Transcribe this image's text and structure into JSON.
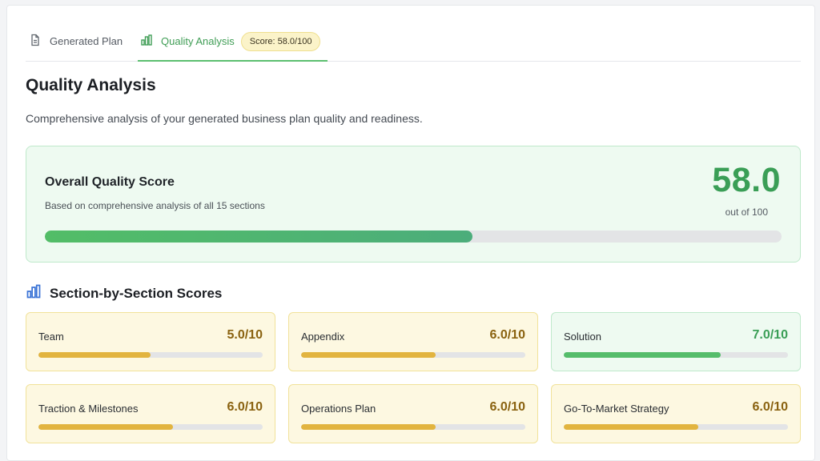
{
  "tabs": {
    "plan_label": "Generated Plan",
    "quality_label": "Quality Analysis",
    "score_badge": "Score: 58.0/100"
  },
  "page": {
    "title": "Quality Analysis",
    "description": "Comprehensive analysis of your generated business plan quality and readiness."
  },
  "overall": {
    "title": "Overall Quality Score",
    "subtitle": "Based on comprehensive analysis of all 15 sections",
    "score": "58.0",
    "out_of": "out of 100",
    "progress": 0.58
  },
  "sections": {
    "heading": "Section-by-Section Scores",
    "items": [
      {
        "label": "Team",
        "score": "5.0/10",
        "progress": 0.5,
        "status": "warning"
      },
      {
        "label": "Appendix",
        "score": "6.0/10",
        "progress": 0.6,
        "status": "warning"
      },
      {
        "label": "Solution",
        "score": "7.0/10",
        "progress": 0.7,
        "status": "good"
      },
      {
        "label": "Traction & Milestones",
        "score": "6.0/10",
        "progress": 0.6,
        "status": "warning"
      },
      {
        "label": "Operations Plan",
        "score": "6.0/10",
        "progress": 0.6,
        "status": "warning"
      },
      {
        "label": "Go-To-Market Strategy",
        "score": "6.0/10",
        "progress": 0.6,
        "status": "warning"
      }
    ]
  },
  "colors": {
    "accent_green": "#3a9e56",
    "warning_gold": "#e2b43f",
    "score_text_gold": "#8a6210"
  },
  "icons": {
    "plan_tab": "document-icon",
    "quality_tab": "bar-chart-icon",
    "section_heading": "bar-chart-icon"
  }
}
